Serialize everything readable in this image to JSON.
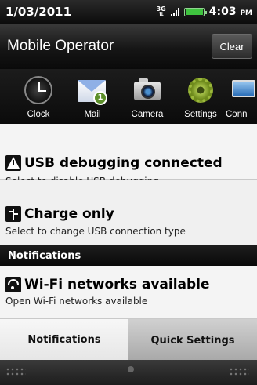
{
  "status_bar": {
    "date": "1/03/2011",
    "network": "3G",
    "time": "4:03",
    "ampm": "PM"
  },
  "operator": {
    "name": "Mobile Operator",
    "clear_label": "Clear"
  },
  "apps": [
    {
      "label": "Clock",
      "icon": "clock-icon"
    },
    {
      "label": "Mail",
      "icon": "mail-icon",
      "badge": "1"
    },
    {
      "label": "Camera",
      "icon": "camera-icon"
    },
    {
      "label": "Settings",
      "icon": "settings-icon"
    },
    {
      "label": "Conn",
      "icon": "connect-icon"
    }
  ],
  "notifications": {
    "usb": {
      "title": "USB debugging connected",
      "subtitle": "Select to disable USB debugging.",
      "icon": "warning-icon"
    },
    "charge": {
      "title": "Charge only",
      "subtitle": "Select to change USB connection type",
      "icon": "usb-icon"
    },
    "section_title": "Notifications",
    "wifi": {
      "title": "Wi-Fi networks available",
      "subtitle": "Open Wi-Fi networks available",
      "icon": "wifi-icon"
    }
  },
  "tabs": {
    "notifications": "Notifications",
    "quick_settings": "Quick Settings"
  },
  "colors": {
    "battery": "#3fc43f",
    "card_bg": "#f4f4f4",
    "bar_bg": "#111111"
  }
}
